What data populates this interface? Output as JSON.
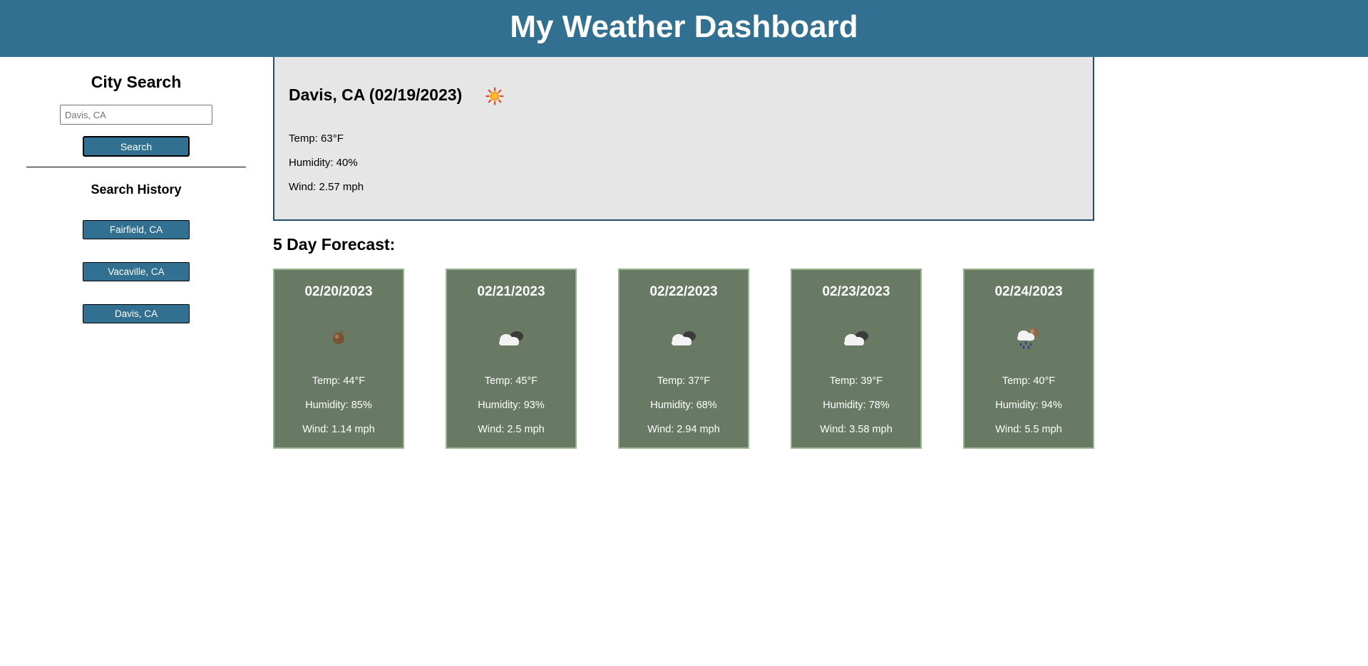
{
  "header": {
    "title": "My Weather Dashboard"
  },
  "sidebar": {
    "search_title": "City Search",
    "search_placeholder": "Davis, CA",
    "search_button": "Search",
    "history_title": "Search History",
    "history": [
      "Fairfield, CA",
      "Vacaville, CA",
      "Davis, CA"
    ]
  },
  "current": {
    "title": "Davis, CA (02/19/2023)",
    "icon": "sun-icon",
    "temp": "Temp: 63°F",
    "humidity": "Humidity: 40%",
    "wind": "Wind: 2.57 mph"
  },
  "forecast": {
    "title": "5 Day Forecast:",
    "days": [
      {
        "date": "02/20/2023",
        "icon": "brown-orb-icon",
        "temp": "Temp: 44°F",
        "humidity": "Humidity: 85%",
        "wind": "Wind: 1.14 mph"
      },
      {
        "date": "02/21/2023",
        "icon": "cloud-icon",
        "temp": "Temp: 45°F",
        "humidity": "Humidity: 93%",
        "wind": "Wind: 2.5 mph"
      },
      {
        "date": "02/22/2023",
        "icon": "cloud-icon",
        "temp": "Temp: 37°F",
        "humidity": "Humidity: 68%",
        "wind": "Wind: 2.94 mph"
      },
      {
        "date": "02/23/2023",
        "icon": "cloud-icon",
        "temp": "Temp: 39°F",
        "humidity": "Humidity: 78%",
        "wind": "Wind: 3.58 mph"
      },
      {
        "date": "02/24/2023",
        "icon": "rain-cloud-icon",
        "temp": "Temp: 40°F",
        "humidity": "Humidity: 94%",
        "wind": "Wind: 5.5 mph"
      }
    ]
  },
  "colors": {
    "header_bg": "#317090",
    "button_bg": "#317090",
    "current_bg": "#e6e6e6",
    "card_bg": "#687a63",
    "card_border": "#97b48e"
  }
}
